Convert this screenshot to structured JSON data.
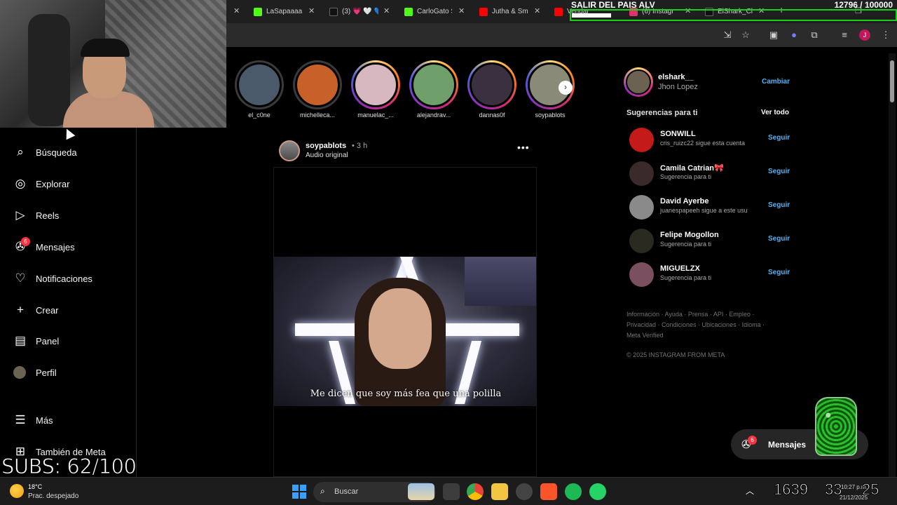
{
  "overlay": {
    "title": "SALIR DEL PAIS ALV",
    "counter": "12796 / 100000",
    "subs": "SUBS: 62/100"
  },
  "tabs": [
    {
      "label": "LaSapaaaa",
      "color": "#53fc18"
    },
    {
      "label": "(3) 💗 🤍 💙",
      "color": "#111111"
    },
    {
      "label": "CarloGato S",
      "color": "#53fc18"
    },
    {
      "label": "Jutha & Sm",
      "color": "#ff0000"
    },
    {
      "label": "Vendar B",
      "color": "#ff0000"
    },
    {
      "label": "(6) Instagr",
      "color": "#e1306c"
    },
    {
      "label": "ElShark_Cl",
      "color": "#111111"
    }
  ],
  "sidebar": {
    "items": [
      {
        "label": "Búsqueda",
        "icon": "search-icon"
      },
      {
        "label": "Explorar",
        "icon": "compass-icon"
      },
      {
        "label": "Reels",
        "icon": "reels-icon"
      },
      {
        "label": "Mensajes",
        "icon": "messenger-icon",
        "badge": "6"
      },
      {
        "label": "Notificaciones",
        "icon": "heart-icon"
      },
      {
        "label": "Crear",
        "icon": "plus-icon"
      },
      {
        "label": "Panel",
        "icon": "chart-icon"
      },
      {
        "label": "Perfil",
        "icon": "avatar"
      },
      {
        "label": "Más",
        "icon": "menu-icon"
      },
      {
        "label": "También de Meta",
        "icon": "meta-icon"
      }
    ]
  },
  "stories": [
    {
      "name": "el_c0ne",
      "seen": true,
      "color": "#4a5a6a"
    },
    {
      "name": "michelleca...",
      "seen": true,
      "color": "#c8602a"
    },
    {
      "name": "manuelac_...",
      "seen": false,
      "color": "#d8b8c0"
    },
    {
      "name": "alejandrav...",
      "seen": false,
      "color": "#6f9f6a"
    },
    {
      "name": "dannas0f",
      "seen": false,
      "color": "#3a3040"
    },
    {
      "name": "soypablots",
      "seen": false,
      "color": "#8a8a78"
    }
  ],
  "post": {
    "user": "soypablots",
    "time": "• 3 h",
    "audio": "Audio original",
    "more": "•••",
    "caption": "Me dicen que soy más fea que una polilla"
  },
  "right": {
    "username": "elshark__",
    "fullname": "Jhon Lopez",
    "switch": "Cambiar",
    "sugg_title": "Sugerencias para ti",
    "see_all": "Ver todo",
    "suggestions": [
      {
        "user": "SONWILL",
        "sub": "cris_ruizc22 sigue esta cuenta",
        "follow": "Seguir",
        "color": "#c41a1a"
      },
      {
        "user": "Camila Catrian🎀",
        "sub": "Sugerencia para ti",
        "follow": "Seguir",
        "color": "#3a2a2a"
      },
      {
        "user": "David Ayerbe",
        "sub": "juanespapeeh sigue a este usu",
        "follow": "Seguir",
        "color": "#8a8a8a"
      },
      {
        "user": "Felipe Mogollon",
        "sub": "Sugerencia para ti",
        "follow": "Seguir",
        "color": "#2a2a20"
      },
      {
        "user": "MIGUELZX",
        "sub": "Sugerencia para ti",
        "follow": "Seguir",
        "color": "#7a5060"
      }
    ],
    "footer_lines": [
      "Información · Ayuda · Prensa · API · Empleo ·",
      "Privacidad · Condiciones · Ubicaciones · Idioma ·",
      "Meta Verified"
    ],
    "copyright": "© 2025 INSTAGRAM FROM META"
  },
  "floating_messages": {
    "label": "Mensajes",
    "badge": "6"
  },
  "taskbar": {
    "temp": "18°C",
    "weather": "Prac. despejado",
    "search": "Buscar",
    "clock_a": "1639",
    "clock_b": "33",
    "clock_c": "25",
    "time": "10:27 p.m.",
    "date": "21/12/2025"
  }
}
